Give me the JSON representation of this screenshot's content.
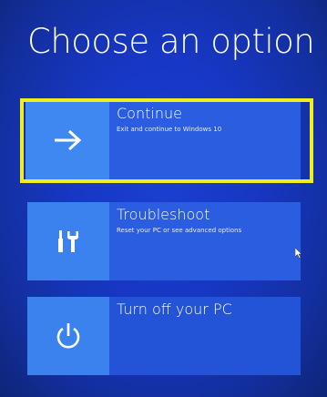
{
  "screen": {
    "title": "Choose an option"
  },
  "options": [
    {
      "label": "Continue",
      "description": "Exit and continue to Windows 10",
      "icon": "arrow-right-icon"
    },
    {
      "label": "Troubleshoot",
      "description": "Reset your PC or see advanced options",
      "icon": "tools-icon"
    },
    {
      "label": "Turn off your PC",
      "description": "",
      "icon": "power-icon"
    }
  ],
  "colors": {
    "background": "#1737c4",
    "tile": "#3b82ee",
    "text_panel": "#2b5de0",
    "highlight": "#f2ee1c"
  }
}
